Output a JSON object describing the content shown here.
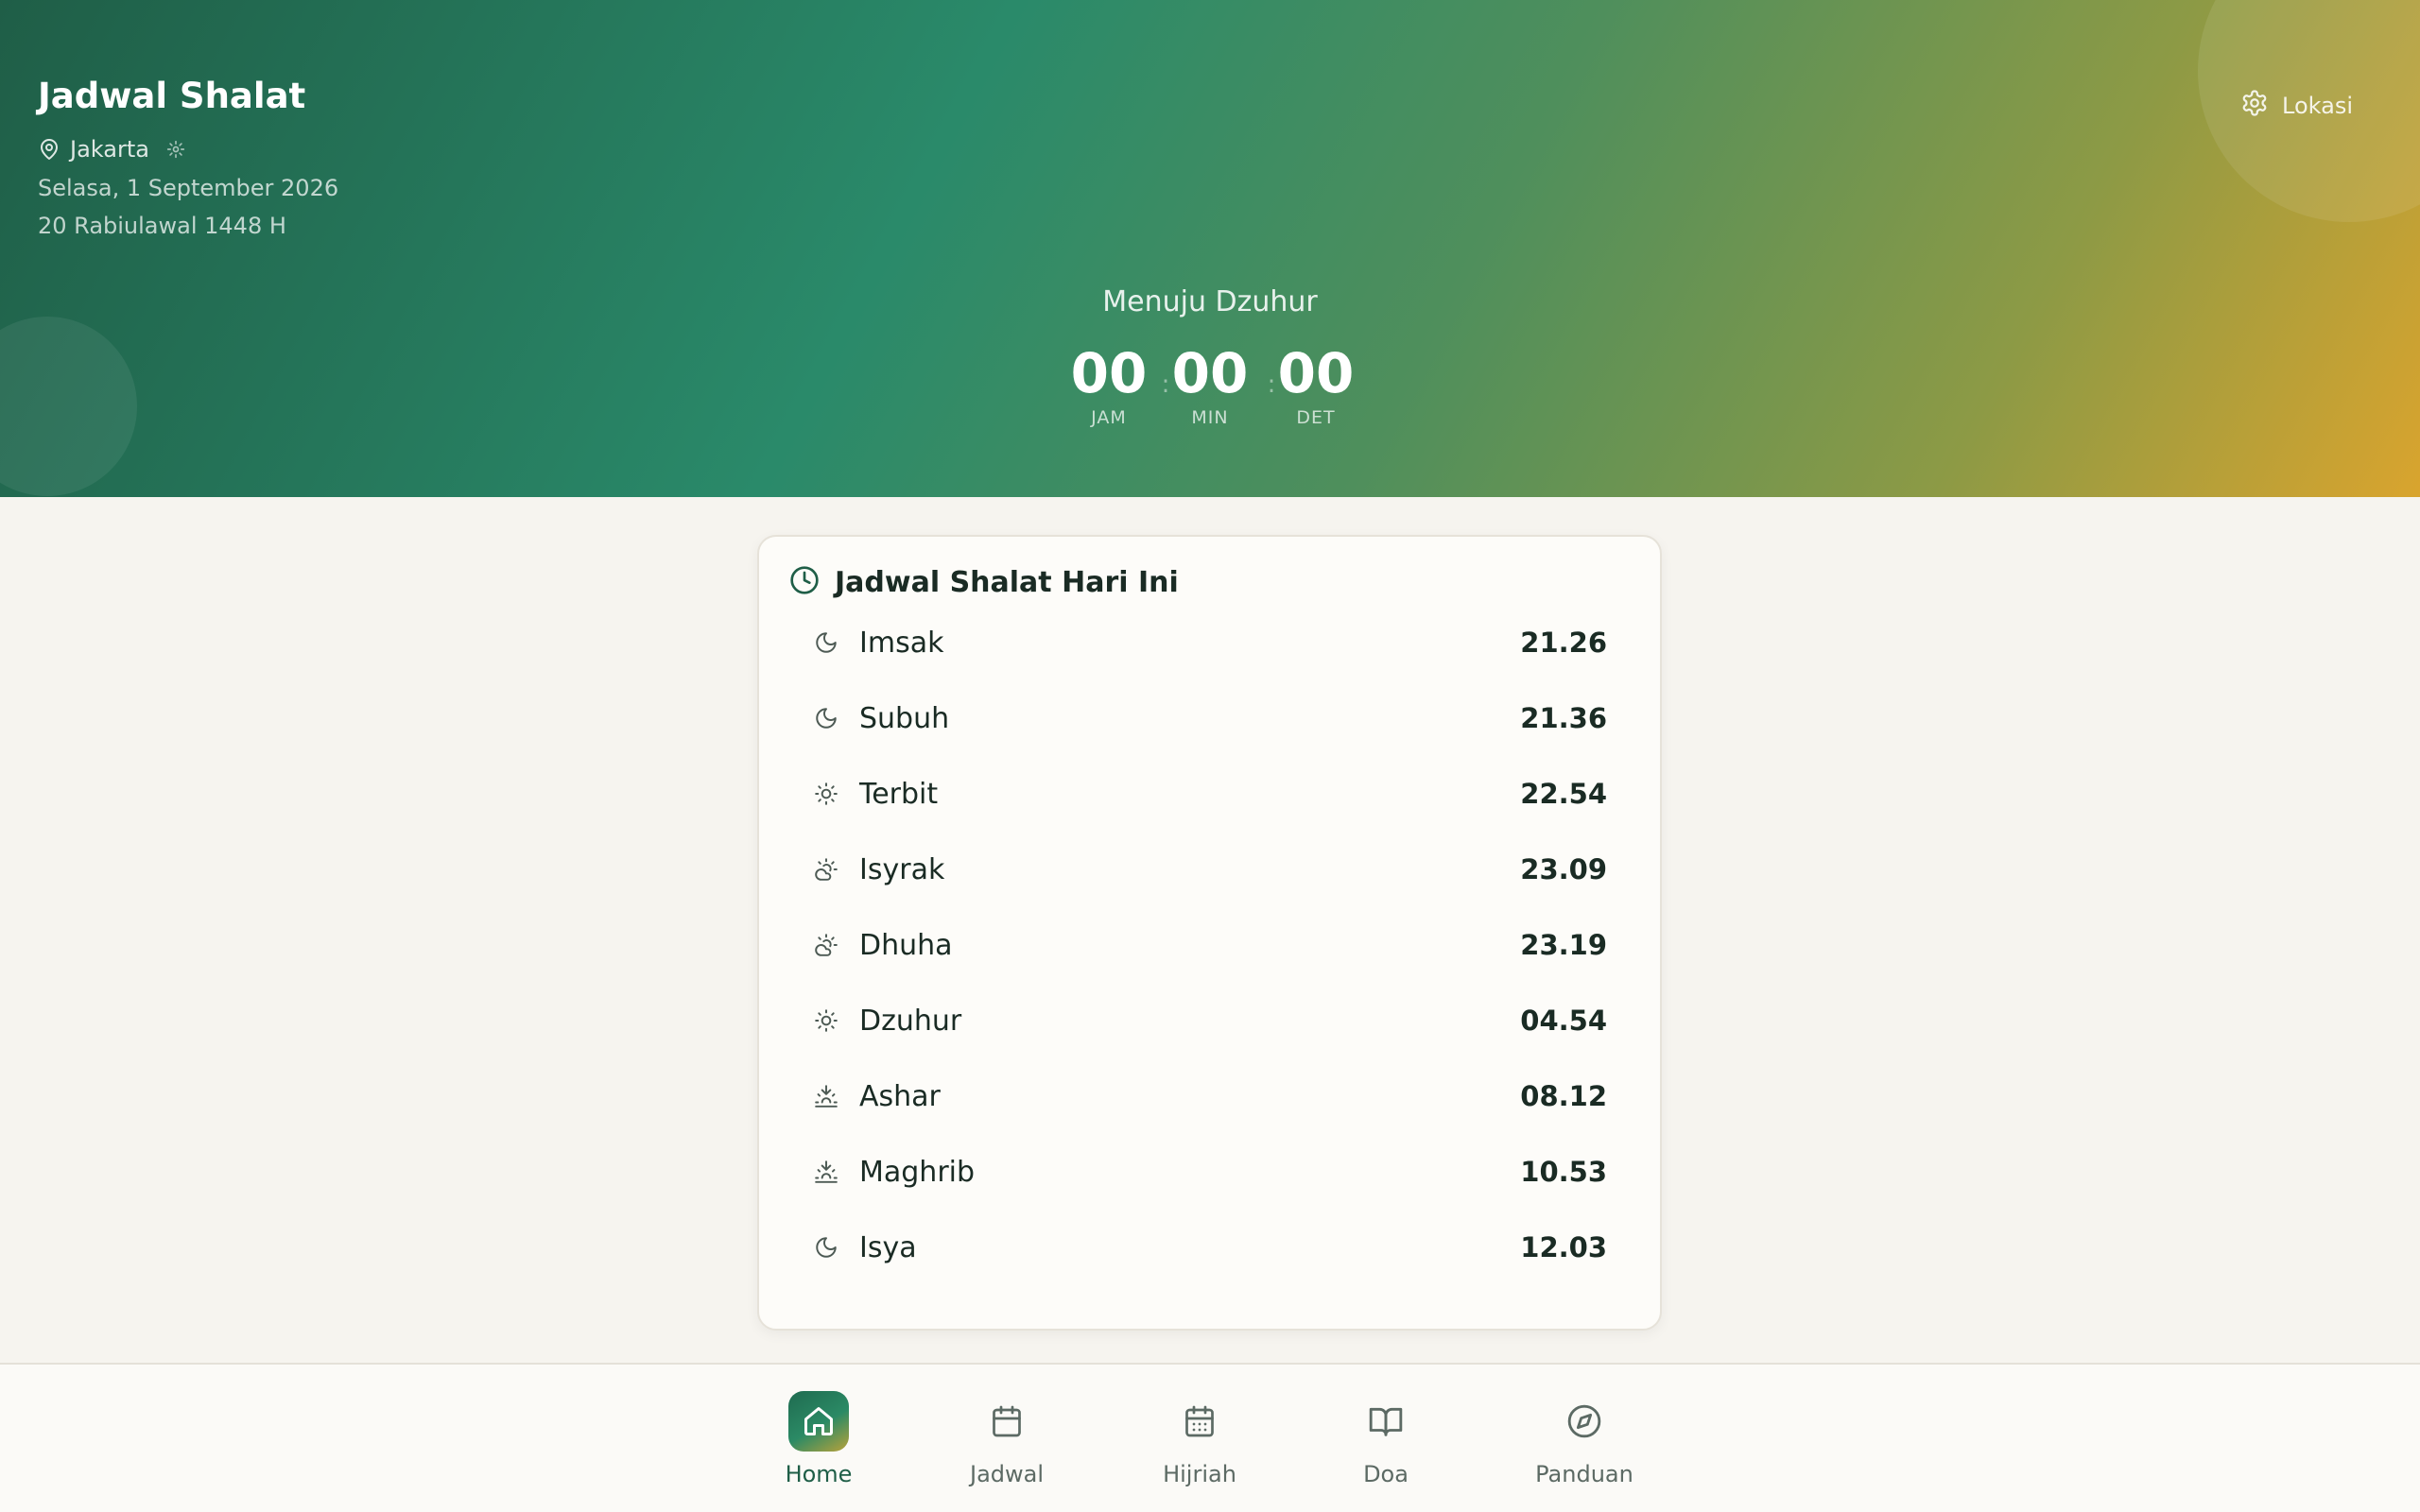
{
  "header": {
    "title": "Jadwal Shalat",
    "city": "Jakarta",
    "gregorian_date": "Selasa, 1 September 2026",
    "hijri_date": "20 Rabiulawal 1448 H",
    "location_button": "Lokasi"
  },
  "countdown": {
    "label": "Menuju Dzuhur",
    "hours": "00",
    "hours_label": "JAM",
    "minutes": "00",
    "minutes_label": "MIN",
    "seconds": "00",
    "seconds_label": "DET"
  },
  "schedule": {
    "title": "Jadwal Shalat Hari Ini",
    "items": [
      {
        "name": "Imsak",
        "time": "21.26",
        "icon": "moon-icon"
      },
      {
        "name": "Subuh",
        "time": "21.36",
        "icon": "moon-icon"
      },
      {
        "name": "Terbit",
        "time": "22.54",
        "icon": "sun-icon"
      },
      {
        "name": "Isyrak",
        "time": "23.09",
        "icon": "cloud-sun-icon"
      },
      {
        "name": "Dhuha",
        "time": "23.19",
        "icon": "cloud-sun-icon"
      },
      {
        "name": "Dzuhur",
        "time": "04.54",
        "icon": "sun-icon"
      },
      {
        "name": "Ashar",
        "time": "08.12",
        "icon": "sunset-icon"
      },
      {
        "name": "Maghrib",
        "time": "10.53",
        "icon": "sunset-icon"
      },
      {
        "name": "Isya",
        "time": "12.03",
        "icon": "moon-icon"
      }
    ]
  },
  "nav": {
    "items": [
      {
        "label": "Home",
        "icon": "home-icon",
        "active": true
      },
      {
        "label": "Jadwal",
        "icon": "calendar-icon",
        "active": false
      },
      {
        "label": "Hijriah",
        "icon": "calendar-grid-icon",
        "active": false
      },
      {
        "label": "Doa",
        "icon": "book-icon",
        "active": false
      },
      {
        "label": "Panduan",
        "icon": "compass-icon",
        "active": false
      }
    ]
  },
  "colors": {
    "primary": "#1f5e47",
    "accent": "#d9a42e",
    "background": "#f6f4ef"
  }
}
